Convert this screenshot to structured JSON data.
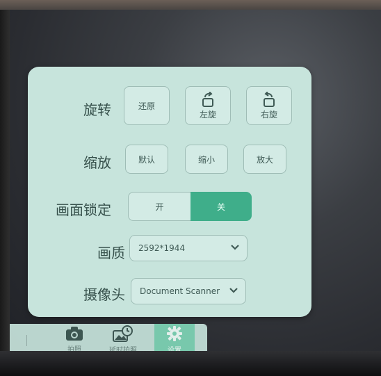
{
  "panel": {
    "rotate": {
      "label": "旋转",
      "reset": "还原",
      "left": "左旋",
      "right": "右旋"
    },
    "zoom": {
      "label": "缩放",
      "default": "默认",
      "shrink": "缩小",
      "enlarge": "放大"
    },
    "lock": {
      "label": "画面锁定",
      "on": "开",
      "off": "关",
      "selected": "关"
    },
    "quality": {
      "label": "画质",
      "value": "2592*1944"
    },
    "camera": {
      "label": "摄像头",
      "value": "Document Scanner"
    }
  },
  "toolbar": {
    "photo": "拍照",
    "timer": "延时拍照",
    "settings": "设置",
    "active": "设置"
  },
  "colors": {
    "panel_bg": "#c7e4dc",
    "accent_green": "#3fae8a",
    "toolbar_active": "#7fd6b7"
  },
  "icons": [
    "rotate-left-icon",
    "rotate-right-icon",
    "camera-icon",
    "timer-photo-icon",
    "settings-gear-icon",
    "chevron-down-icon"
  ]
}
